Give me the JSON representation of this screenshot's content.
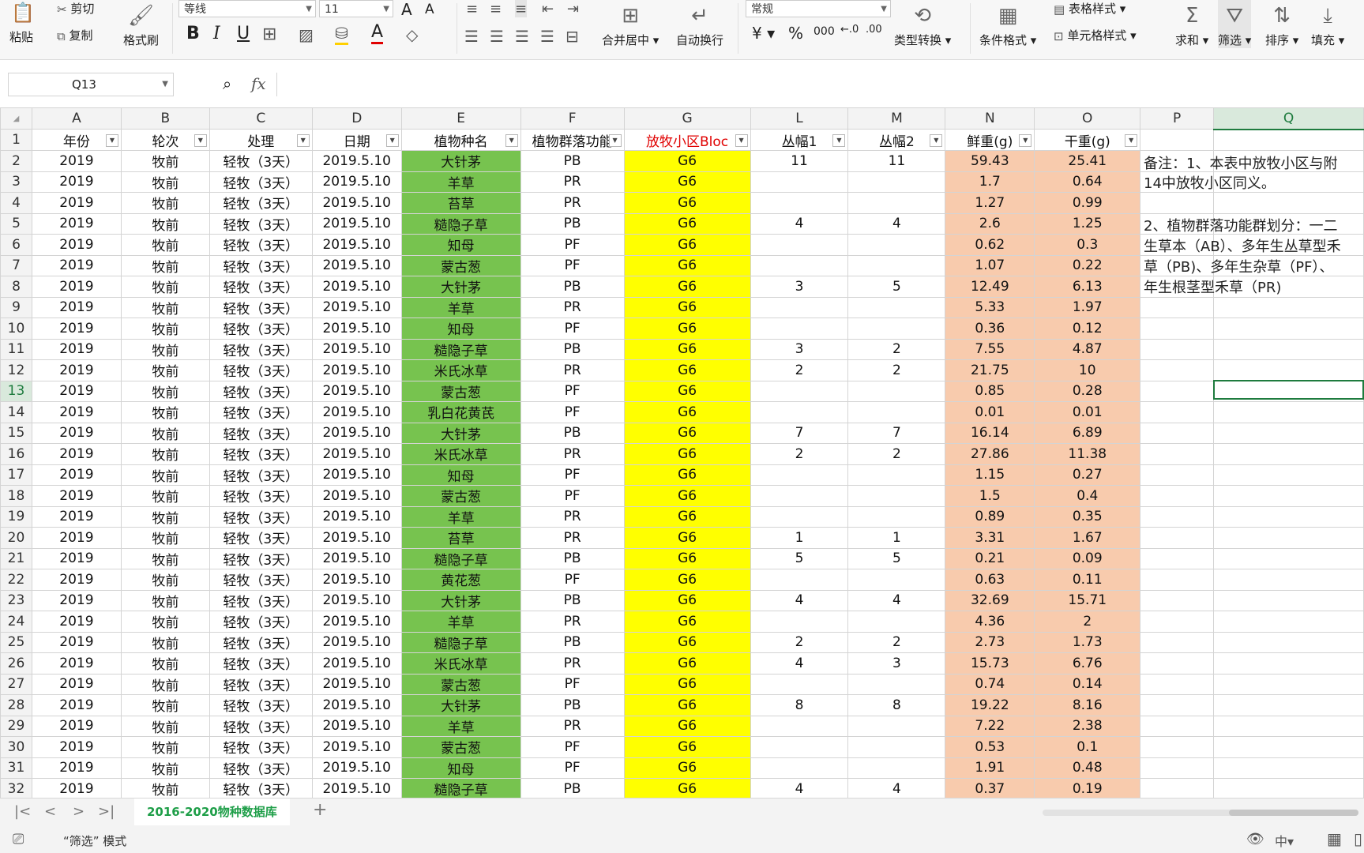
{
  "ribbon": {
    "paste": "粘贴",
    "cut": "剪切",
    "copy": "复制",
    "format_painter": "格式刷",
    "font_name": "等线",
    "font_size": "11",
    "merge_center": "合并居中",
    "wrap_text": "自动换行",
    "number_format": "常规",
    "type_convert": "类型转换",
    "cond_format": "条件格式",
    "table_style": "表格样式",
    "cell_style": "单元格样式",
    "sum": "求和",
    "filter": "筛选",
    "sort": "排序",
    "fill": "填充",
    "currency": "¥",
    "percent": "%",
    "thousands": "000",
    "bold": "B",
    "italic": "I",
    "underline": "U"
  },
  "formula_bar": {
    "cell_ref": "Q13",
    "fx": "fx",
    "value": ""
  },
  "columns": [
    "A",
    "B",
    "C",
    "D",
    "E",
    "F",
    "G",
    "L",
    "M",
    "N",
    "O",
    "P",
    "Q"
  ],
  "headers": [
    "年份",
    "轮次",
    "处理",
    "日期",
    "植物种名",
    "植物群落功能",
    "放牧小区Bloc",
    "丛幅1",
    "丛幅2",
    "鲜重(g)",
    "干重(g)"
  ],
  "rows": [
    [
      "2019",
      "牧前",
      "轻牧（3天）",
      "2019.5.10",
      "大针茅",
      "PB",
      "G6",
      "11",
      "11",
      "59.43",
      "25.41"
    ],
    [
      "2019",
      "牧前",
      "轻牧（3天）",
      "2019.5.10",
      "羊草",
      "PR",
      "G6",
      "",
      "",
      "1.7",
      "0.64"
    ],
    [
      "2019",
      "牧前",
      "轻牧（3天）",
      "2019.5.10",
      "苔草",
      "PR",
      "G6",
      "",
      "",
      "1.27",
      "0.99"
    ],
    [
      "2019",
      "牧前",
      "轻牧（3天）",
      "2019.5.10",
      "糙隐子草",
      "PB",
      "G6",
      "4",
      "4",
      "2.6",
      "1.25"
    ],
    [
      "2019",
      "牧前",
      "轻牧（3天）",
      "2019.5.10",
      "知母",
      "PF",
      "G6",
      "",
      "",
      "0.62",
      "0.3"
    ],
    [
      "2019",
      "牧前",
      "轻牧（3天）",
      "2019.5.10",
      "蒙古葱",
      "PF",
      "G6",
      "",
      "",
      "1.07",
      "0.22"
    ],
    [
      "2019",
      "牧前",
      "轻牧（3天）",
      "2019.5.10",
      "大针茅",
      "PB",
      "G6",
      "3",
      "5",
      "12.49",
      "6.13"
    ],
    [
      "2019",
      "牧前",
      "轻牧（3天）",
      "2019.5.10",
      "羊草",
      "PR",
      "G6",
      "",
      "",
      "5.33",
      "1.97"
    ],
    [
      "2019",
      "牧前",
      "轻牧（3天）",
      "2019.5.10",
      "知母",
      "PF",
      "G6",
      "",
      "",
      "0.36",
      "0.12"
    ],
    [
      "2019",
      "牧前",
      "轻牧（3天）",
      "2019.5.10",
      "糙隐子草",
      "PB",
      "G6",
      "3",
      "2",
      "7.55",
      "4.87"
    ],
    [
      "2019",
      "牧前",
      "轻牧（3天）",
      "2019.5.10",
      "米氏冰草",
      "PR",
      "G6",
      "2",
      "2",
      "21.75",
      "10"
    ],
    [
      "2019",
      "牧前",
      "轻牧（3天）",
      "2019.5.10",
      "蒙古葱",
      "PF",
      "G6",
      "",
      "",
      "0.85",
      "0.28"
    ],
    [
      "2019",
      "牧前",
      "轻牧（3天）",
      "2019.5.10",
      "乳白花黄芪",
      "PF",
      "G6",
      "",
      "",
      "0.01",
      "0.01"
    ],
    [
      "2019",
      "牧前",
      "轻牧（3天）",
      "2019.5.10",
      "大针茅",
      "PB",
      "G6",
      "7",
      "7",
      "16.14",
      "6.89"
    ],
    [
      "2019",
      "牧前",
      "轻牧（3天）",
      "2019.5.10",
      "米氏冰草",
      "PR",
      "G6",
      "2",
      "2",
      "27.86",
      "11.38"
    ],
    [
      "2019",
      "牧前",
      "轻牧（3天）",
      "2019.5.10",
      "知母",
      "PF",
      "G6",
      "",
      "",
      "1.15",
      "0.27"
    ],
    [
      "2019",
      "牧前",
      "轻牧（3天）",
      "2019.5.10",
      "蒙古葱",
      "PF",
      "G6",
      "",
      "",
      "1.5",
      "0.4"
    ],
    [
      "2019",
      "牧前",
      "轻牧（3天）",
      "2019.5.10",
      "羊草",
      "PR",
      "G6",
      "",
      "",
      "0.89",
      "0.35"
    ],
    [
      "2019",
      "牧前",
      "轻牧（3天）",
      "2019.5.10",
      "苔草",
      "PR",
      "G6",
      "1",
      "1",
      "3.31",
      "1.67"
    ],
    [
      "2019",
      "牧前",
      "轻牧（3天）",
      "2019.5.10",
      "糙隐子草",
      "PB",
      "G6",
      "5",
      "5",
      "0.21",
      "0.09"
    ],
    [
      "2019",
      "牧前",
      "轻牧（3天）",
      "2019.5.10",
      "黄花葱",
      "PF",
      "G6",
      "",
      "",
      "0.63",
      "0.11"
    ],
    [
      "2019",
      "牧前",
      "轻牧（3天）",
      "2019.5.10",
      "大针茅",
      "PB",
      "G6",
      "4",
      "4",
      "32.69",
      "15.71"
    ],
    [
      "2019",
      "牧前",
      "轻牧（3天）",
      "2019.5.10",
      "羊草",
      "PR",
      "G6",
      "",
      "",
      "4.36",
      "2"
    ],
    [
      "2019",
      "牧前",
      "轻牧（3天）",
      "2019.5.10",
      "糙隐子草",
      "PB",
      "G6",
      "2",
      "2",
      "2.73",
      "1.73"
    ],
    [
      "2019",
      "牧前",
      "轻牧（3天）",
      "2019.5.10",
      "米氏冰草",
      "PR",
      "G6",
      "4",
      "3",
      "15.73",
      "6.76"
    ],
    [
      "2019",
      "牧前",
      "轻牧（3天）",
      "2019.5.10",
      "蒙古葱",
      "PF",
      "G6",
      "",
      "",
      "0.74",
      "0.14"
    ],
    [
      "2019",
      "牧前",
      "轻牧（3天）",
      "2019.5.10",
      "大针茅",
      "PB",
      "G6",
      "8",
      "8",
      "19.22",
      "8.16"
    ],
    [
      "2019",
      "牧前",
      "轻牧（3天）",
      "2019.5.10",
      "羊草",
      "PR",
      "G6",
      "",
      "",
      "7.22",
      "2.38"
    ],
    [
      "2019",
      "牧前",
      "轻牧（3天）",
      "2019.5.10",
      "蒙古葱",
      "PF",
      "G6",
      "",
      "",
      "0.53",
      "0.1"
    ],
    [
      "2019",
      "牧前",
      "轻牧（3天）",
      "2019.5.10",
      "知母",
      "PF",
      "G6",
      "",
      "",
      "1.91",
      "0.48"
    ],
    [
      "2019",
      "牧前",
      "轻牧（3天）",
      "2019.5.10",
      "糙隐子草",
      "PB",
      "G6",
      "4",
      "4",
      "0.37",
      "0.19"
    ]
  ],
  "notes": [
    "备注：1、本表中放牧小区与附",
    "14中放牧小区同义。",
    "2、植物群落功能群划分：一二",
    "生草本（AB）、多年生丛草型禾",
    "草（PB)、多年生杂草（PF）、",
    "年生根茎型禾草（PR)"
  ],
  "sheet_tab": "2016-2020物种数据库",
  "status": {
    "mode": "“筛选” 模式"
  },
  "colors": {
    "species_fill": "#77c34f",
    "block_fill": "#ffff00",
    "weight_fill": "#f8cbad",
    "accent": "#1e9e48"
  }
}
